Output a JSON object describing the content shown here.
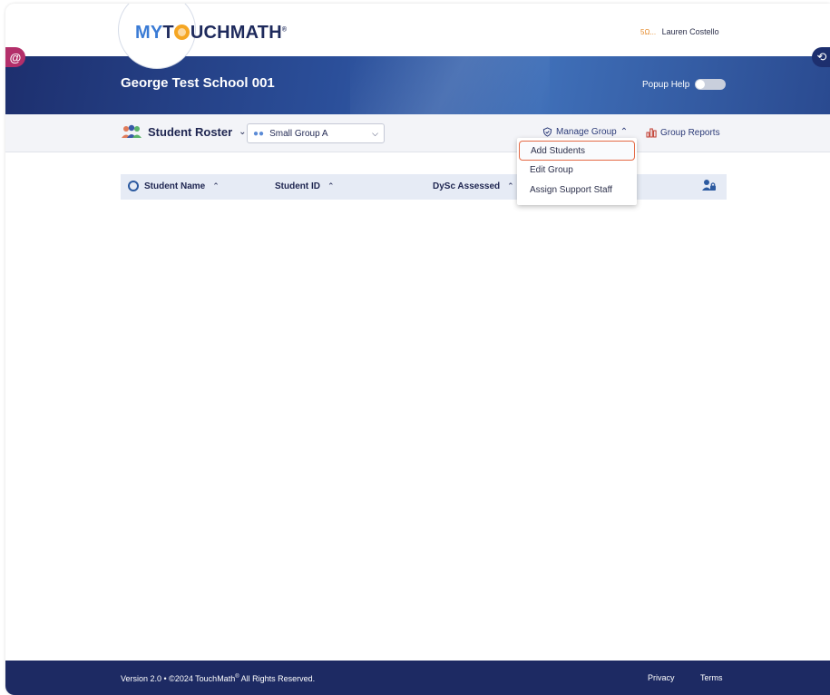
{
  "header": {
    "logo": {
      "my": "MY",
      "t": "T",
      "rest": "UCHMATH",
      "mark": "®"
    },
    "user": {
      "badge": "5Ω...",
      "name": "Lauren Costello"
    },
    "school_name": "George Test School 001",
    "popup_help_label": "Popup Help",
    "popup_help_enabled": false
  },
  "toolbar": {
    "roster_title": "Student Roster",
    "group_select_value": "Small Group A",
    "manage_group_label": "Manage Group",
    "group_reports_label": "Group Reports"
  },
  "manage_menu": {
    "items": [
      {
        "label": "Add Students"
      },
      {
        "label": "Edit Group"
      },
      {
        "label": "Assign Support Staff"
      }
    ]
  },
  "table": {
    "columns": [
      "Student Name",
      "Student ID",
      "DySc Assessed"
    ],
    "rows": []
  },
  "footer": {
    "copyright_prefix": "Version 2.0 • ©2024 TouchMath",
    "registered": "®",
    "copyright_suffix": " All Rights Reserved.",
    "privacy": "Privacy",
    "terms": "Terms"
  },
  "colors": {
    "banner": "#2b4f9a",
    "footer": "#1d2a63",
    "menu_highlight": "#e46a45",
    "left_extension": "#b32f6a"
  },
  "icons": [
    "group-icon",
    "small-group-icon",
    "shield-check-icon",
    "bar-chart-icon",
    "gear-icon",
    "user-lock-icon",
    "chevron-down-icon",
    "chevron-up-icon"
  ]
}
